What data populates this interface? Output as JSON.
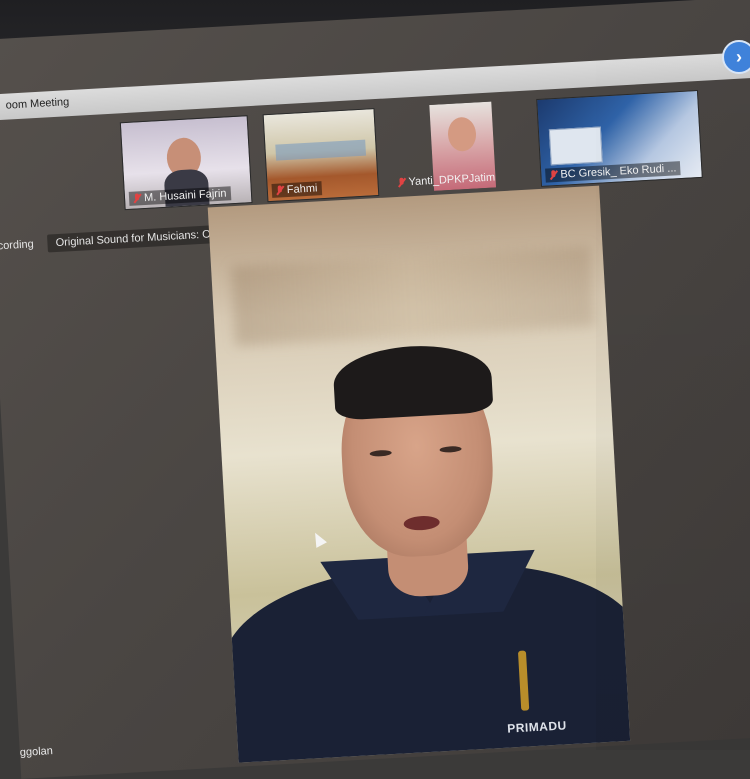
{
  "window": {
    "title": "oom Meeting"
  },
  "participants": [
    {
      "name": "M. Husaini Fajrin",
      "muted": true
    },
    {
      "name": "Fahmi",
      "muted": true
    },
    {
      "name": "Yanti_DPKPJatim",
      "muted": true
    },
    {
      "name": "BC Gresik_ Eko Rudi ...",
      "muted": true
    }
  ],
  "status_bar": {
    "recording": "ecording",
    "original_sound": "Original Sound for Musicians: Off"
  },
  "speaker": {
    "shirt_brand": "PRIMADU"
  },
  "bottom_left_label": "ggolan",
  "colors": {
    "accent": "#3f82db",
    "mute_red": "#e04343"
  },
  "icons": {
    "next": "chevron-right-icon",
    "mic_muted": "mic-muted-icon",
    "cursor": "mouse-cursor-icon"
  }
}
